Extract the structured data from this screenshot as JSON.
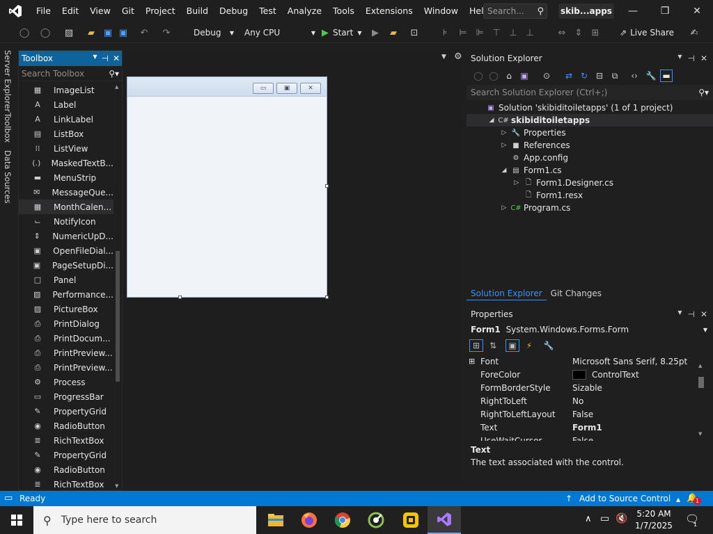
{
  "menu": {
    "items": [
      "File",
      "Edit",
      "View",
      "Git",
      "Project",
      "Build",
      "Debug",
      "Test",
      "Analyze",
      "Tools",
      "Extensions",
      "Window",
      "Help"
    ],
    "search_placeholder": "Search...",
    "solution_name": "skib...apps"
  },
  "toolbar": {
    "config": "Debug",
    "platform": "Any CPU",
    "start_label": "Start",
    "live_share_label": "Live Share"
  },
  "vertical_tabs": [
    "Server Explorer",
    "Toolbox",
    "Data Sources"
  ],
  "toolbox": {
    "title": "Toolbox",
    "search_placeholder": "Search Toolbox",
    "items": [
      {
        "label": "ImageList",
        "icon": "image-list-icon",
        "glyph": "▦"
      },
      {
        "label": "Label",
        "icon": "label-icon",
        "glyph": "A"
      },
      {
        "label": "LinkLabel",
        "icon": "link-label-icon",
        "glyph": "A"
      },
      {
        "label": "ListBox",
        "icon": "list-box-icon",
        "glyph": "▤"
      },
      {
        "label": "ListView",
        "icon": "list-view-icon",
        "glyph": "⁞⁞"
      },
      {
        "label": "MaskedTextB...",
        "icon": "masked-textbox-icon",
        "glyph": "(.)"
      },
      {
        "label": "MenuStrip",
        "icon": "menu-strip-icon",
        "glyph": "▬"
      },
      {
        "label": "MessageQue...",
        "icon": "message-queue-icon",
        "glyph": "✉"
      },
      {
        "label": "MonthCalen...",
        "icon": "month-calendar-icon",
        "glyph": "▦"
      },
      {
        "label": "NotifyIcon",
        "icon": "notify-icon-icon",
        "glyph": "⌙"
      },
      {
        "label": "NumericUpD...",
        "icon": "numeric-updown-icon",
        "glyph": "⇕"
      },
      {
        "label": "OpenFileDial...",
        "icon": "open-file-dialog-icon",
        "glyph": "▣"
      },
      {
        "label": "PageSetupDi...",
        "icon": "page-setup-icon",
        "glyph": "▣"
      },
      {
        "label": "Panel",
        "icon": "panel-icon",
        "glyph": "□"
      },
      {
        "label": "Performance...",
        "icon": "performance-counter-icon",
        "glyph": "▨"
      },
      {
        "label": "PictureBox",
        "icon": "picture-box-icon",
        "glyph": "▨"
      },
      {
        "label": "PrintDialog",
        "icon": "print-dialog-icon",
        "glyph": "⎙"
      },
      {
        "label": "PrintDocum...",
        "icon": "print-document-icon",
        "glyph": "⎙"
      },
      {
        "label": "PrintPreview...",
        "icon": "print-preview-icon",
        "glyph": "⎙"
      },
      {
        "label": "PrintPreview...",
        "icon": "print-preview-dialog-icon",
        "glyph": "⎙"
      },
      {
        "label": "Process",
        "icon": "process-icon",
        "glyph": "⚙"
      },
      {
        "label": "ProgressBar",
        "icon": "progress-bar-icon",
        "glyph": "▭"
      },
      {
        "label": "PropertyGrid",
        "icon": "property-grid-icon",
        "glyph": "✎"
      },
      {
        "label": "RadioButton",
        "icon": "radio-button-icon",
        "glyph": "◉"
      },
      {
        "label": "RichTextBox",
        "icon": "rich-textbox-icon",
        "glyph": "≣"
      },
      {
        "label": "PropertyGrid",
        "icon": "property-grid-icon",
        "glyph": "✎"
      },
      {
        "label": "RadioButton",
        "icon": "radio-button-icon",
        "glyph": "◉"
      },
      {
        "label": "RichTextBox",
        "icon": "rich-textbox-icon",
        "glyph": "≣"
      }
    ],
    "selected_index": 8
  },
  "solution_explorer": {
    "title": "Solution Explorer",
    "search_placeholder": "Search Solution Explorer (Ctrl+;)",
    "tree": [
      {
        "label": "Solution 'skibiditoiletapps' (1 of 1 project)",
        "indent": 0,
        "arrow": "",
        "icon": "solution-icon",
        "glyph": "▣",
        "color": "#c5a5ff",
        "bold": false
      },
      {
        "label": "skibiditoiletapps",
        "indent": 1,
        "arrow": "◢",
        "icon": "csharp-project-icon",
        "glyph": "C#",
        "color": "#cfcfcf",
        "bold": true
      },
      {
        "label": "Properties",
        "indent": 2,
        "arrow": "▷",
        "icon": "wrench-icon",
        "glyph": "🔧",
        "color": "#cfcfcf",
        "bold": false
      },
      {
        "label": "References",
        "indent": 2,
        "arrow": "▷",
        "icon": "references-icon",
        "glyph": "■",
        "color": "#cfcfcf",
        "bold": false
      },
      {
        "label": "App.config",
        "indent": 2,
        "arrow": "",
        "icon": "config-file-icon",
        "glyph": "⚙",
        "color": "#cfcfcf",
        "bold": false
      },
      {
        "label": "Form1.cs",
        "indent": 2,
        "arrow": "◢",
        "icon": "form-icon",
        "glyph": "▤",
        "color": "#cfcfcf",
        "bold": false
      },
      {
        "label": "Form1.Designer.cs",
        "indent": 3,
        "arrow": "▷",
        "icon": "designer-file-icon",
        "glyph": "🗋",
        "color": "#cfcfcf",
        "bold": false
      },
      {
        "label": "Form1.resx",
        "indent": 3,
        "arrow": "",
        "icon": "resx-file-icon",
        "glyph": "🗋",
        "color": "#cfcfcf",
        "bold": false
      },
      {
        "label": "Program.cs",
        "indent": 2,
        "arrow": "▷",
        "icon": "csharp-file-icon",
        "glyph": "C#",
        "color": "#4ec94e",
        "bold": false
      }
    ],
    "tabs": [
      "Solution Explorer",
      "Git Changes"
    ]
  },
  "properties": {
    "title": "Properties",
    "object_name": "Form1",
    "object_type": "System.Windows.Forms.Form",
    "rows": [
      {
        "name": "Font",
        "value": "Microsoft Sans Serif, 8.25pt",
        "expandable": true,
        "bold": false,
        "swatch": ""
      },
      {
        "name": "ForeColor",
        "value": "ControlText",
        "expandable": false,
        "bold": false,
        "swatch": "#000000"
      },
      {
        "name": "FormBorderStyle",
        "value": "Sizable",
        "expandable": false,
        "bold": false,
        "swatch": ""
      },
      {
        "name": "RightToLeft",
        "value": "No",
        "expandable": false,
        "bold": false,
        "swatch": ""
      },
      {
        "name": "RightToLeftLayout",
        "value": "False",
        "expandable": false,
        "bold": false,
        "swatch": ""
      },
      {
        "name": "Text",
        "value": "Form1",
        "expandable": false,
        "bold": true,
        "swatch": ""
      },
      {
        "name": "UseWaitCursor",
        "value": "False",
        "expandable": false,
        "bold": false,
        "swatch": ""
      }
    ],
    "desc_title": "Text",
    "desc_body": "The text associated with the control."
  },
  "statusbar": {
    "ready": "Ready",
    "source_control": "Add to Source Control",
    "notification_count": "1"
  },
  "taskbar": {
    "search_placeholder": "Type here to search",
    "time": "5:20 AM",
    "date": "1/7/2025",
    "notification_count": "1"
  },
  "colors": {
    "accent": "#0078d4",
    "toolbox_header": "#0e639c",
    "link_tab": "#3794ff"
  }
}
